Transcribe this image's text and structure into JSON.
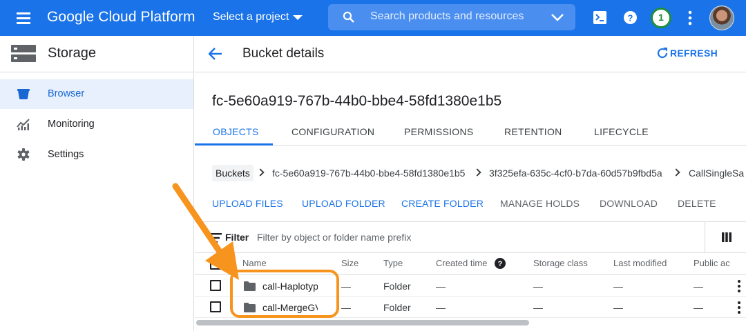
{
  "topbar": {
    "title": "Google Cloud Platform",
    "project_label": "Select a project",
    "search_placeholder": "Search products and resources",
    "notification_count": "1",
    "brand_color": "#1a73e8"
  },
  "sidebar": {
    "title": "Storage",
    "items": [
      {
        "label": "Browser",
        "icon": "bucket-icon",
        "active": true
      },
      {
        "label": "Monitoring",
        "icon": "chart-icon",
        "active": false
      },
      {
        "label": "Settings",
        "icon": "gear-icon",
        "active": false
      }
    ]
  },
  "header": {
    "title": "Bucket details",
    "refresh_label": "REFRESH"
  },
  "bucket": {
    "name": "fc-5e60a919-767b-44b0-bbe4-58fd1380e1b5"
  },
  "tabs": [
    {
      "label": "OBJECTS",
      "active": true
    },
    {
      "label": "CONFIGURATION",
      "active": false
    },
    {
      "label": "PERMISSIONS",
      "active": false
    },
    {
      "label": "RETENTION",
      "active": false
    },
    {
      "label": "LIFECYCLE",
      "active": false
    }
  ],
  "breadcrumb": [
    "Buckets",
    "fc-5e60a919-767b-44b0-bbe4-58fd1380e1b5",
    "3f325efa-635c-4cf0-b7da-60d57b9fbd5a",
    "CallSingleSa"
  ],
  "actions": [
    {
      "label": "UPLOAD FILES",
      "enabled": true
    },
    {
      "label": "UPLOAD FOLDER",
      "enabled": true
    },
    {
      "label": "CREATE FOLDER",
      "enabled": true
    },
    {
      "label": "MANAGE HOLDS",
      "enabled": false
    },
    {
      "label": "DOWNLOAD",
      "enabled": false
    },
    {
      "label": "DELETE",
      "enabled": false
    }
  ],
  "filter": {
    "label": "Filter",
    "placeholder": "Filter by object or folder name prefix"
  },
  "table": {
    "columns": [
      "Name",
      "Size",
      "Type",
      "Created time",
      "Storage class",
      "Last modified",
      "Public ac"
    ],
    "rows": [
      {
        "name": "call-HaplotypeCaller",
        "size": "—",
        "type": "Folder",
        "created": "—",
        "storage": "—",
        "modified": "—",
        "public": "—"
      },
      {
        "name": "call-MergeGVCFs",
        "size": "—",
        "type": "Folder",
        "created": "—",
        "storage": "—",
        "modified": "—",
        "public": "—"
      }
    ]
  },
  "annotation_color": "#f7941d"
}
